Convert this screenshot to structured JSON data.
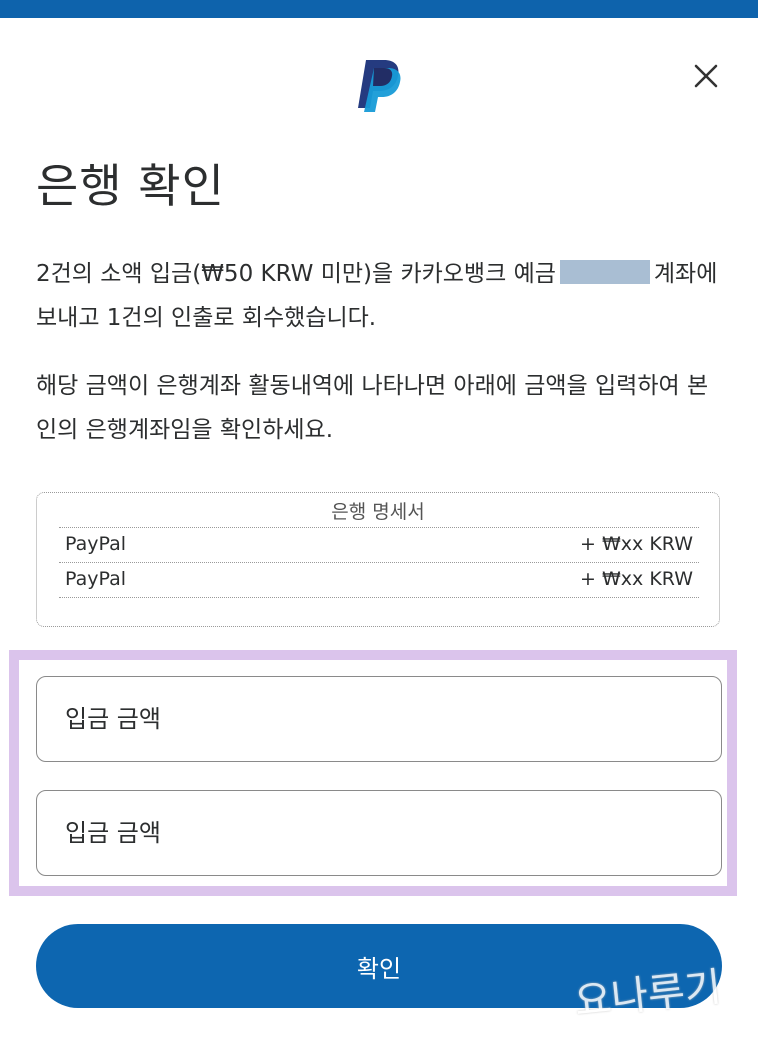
{
  "modal": {
    "logo_icon": "paypal-logo",
    "close_icon": "close-icon",
    "title": "은행 확인",
    "paragraph1_part1": "2건의 소액 입금(₩50 KRW 미만)을 카카오뱅크 예금",
    "paragraph1_part2": "계좌에 보내고 1건의 인출로 회수했습니다.",
    "paragraph2": "해당 금액이 은행계좌 활동내역에 나타나면 아래에 금액을 입력하여 본인의 은행계좌임을 확인하세요."
  },
  "statement": {
    "title": "은행 명세서",
    "rows": [
      {
        "name": "PayPal",
        "amount": "+ ₩xx KRW"
      },
      {
        "name": "PayPal",
        "amount": "+ ₩xx KRW"
      }
    ]
  },
  "form": {
    "field1_placeholder": "입금 금액",
    "field2_placeholder": "입금 금액",
    "confirm_label": "확인"
  },
  "watermark": "요나루기",
  "colors": {
    "topbar": "#0e63ac",
    "button": "#0d66b0",
    "highlight": "#dbc4ec",
    "paypal_dark": "#253b80",
    "paypal_light": "#179bd7"
  }
}
